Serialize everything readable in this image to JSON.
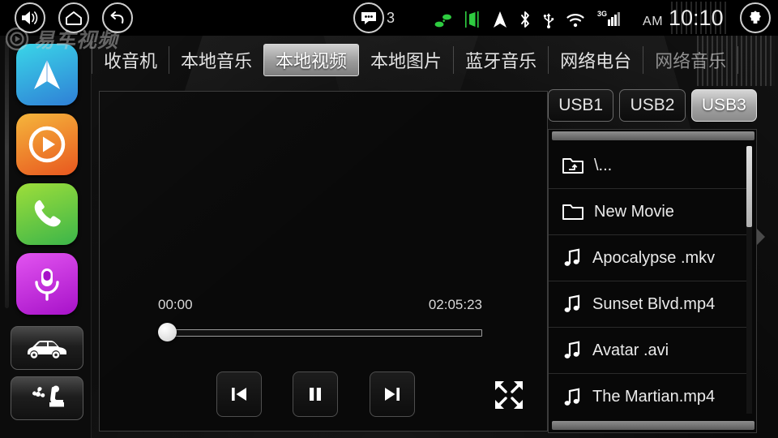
{
  "statusbar": {
    "left_buttons": [
      {
        "name": "volume-icon",
        "label": "Volume"
      },
      {
        "name": "home-icon",
        "label": "Home"
      },
      {
        "name": "back-icon",
        "label": "Back"
      }
    ],
    "message_count": "3",
    "indicator_icons": [
      "parking-sensor-icon",
      "door-open-icon",
      "navigation-arrow-icon",
      "bluetooth-icon",
      "usb-icon",
      "wifi-icon",
      "signal-3g-icon"
    ],
    "signal_label": "3G",
    "ampm": "AM",
    "time": "10:10",
    "right_button": "settings-gear-icon"
  },
  "watermark": {
    "text": "易车视频"
  },
  "sidebar": {
    "apps": [
      {
        "name": "navigation-app",
        "icon": "navigation-arrow-icon",
        "color": "#2f7fd6"
      },
      {
        "name": "media-app",
        "icon": "play-circle-icon",
        "color": "#e8571f"
      },
      {
        "name": "phone-app",
        "icon": "phone-icon",
        "color": "#3bb54a"
      },
      {
        "name": "voice-app",
        "icon": "microphone-icon",
        "color": "#a712c9"
      }
    ],
    "buttons": [
      {
        "name": "car-settings-button",
        "icon": "car-icon"
      },
      {
        "name": "climate-button",
        "icon": "climate-fan-seat-icon"
      }
    ]
  },
  "tabs": [
    {
      "label": "收音机",
      "active": false,
      "dim": false
    },
    {
      "label": "本地音乐",
      "active": false,
      "dim": false
    },
    {
      "label": "本地视频",
      "active": true,
      "dim": false
    },
    {
      "label": "本地图片",
      "active": false,
      "dim": false
    },
    {
      "label": "蓝牙音乐",
      "active": false,
      "dim": false
    },
    {
      "label": "网络电台",
      "active": false,
      "dim": false
    },
    {
      "label": "网络音乐",
      "active": false,
      "dim": true
    }
  ],
  "player": {
    "elapsed": "00:00",
    "duration": "02:05:23",
    "progress_percent": 0,
    "controls": [
      {
        "name": "previous-button",
        "icon": "skip-back-icon"
      },
      {
        "name": "pause-button",
        "icon": "pause-icon"
      },
      {
        "name": "next-button",
        "icon": "skip-forward-icon"
      }
    ],
    "fullscreen": {
      "name": "fullscreen-button",
      "icon": "expand-arrows-icon"
    }
  },
  "filelist": {
    "sources": [
      {
        "label": "USB1",
        "selected": false
      },
      {
        "label": "USB2",
        "selected": false
      },
      {
        "label": "USB3",
        "selected": true
      }
    ],
    "items": [
      {
        "label": "\\...",
        "type": "parent-folder"
      },
      {
        "label": "New Movie",
        "type": "folder"
      },
      {
        "label": "Apocalypse .mkv",
        "type": "file"
      },
      {
        "label": "Sunset Blvd.mp4",
        "type": "file"
      },
      {
        "label": "Avatar .avi",
        "type": "file"
      },
      {
        "label": "The Martian.mp4",
        "type": "file"
      }
    ]
  }
}
